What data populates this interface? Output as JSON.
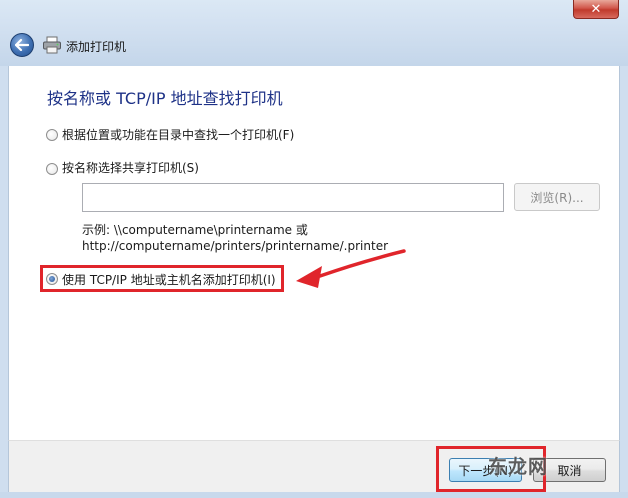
{
  "window": {
    "title": "添加打印机",
    "close_glyph": "✕"
  },
  "page": {
    "heading": "按名称或 TCP/IP 地址查找打印机"
  },
  "options": [
    {
      "label": "根据位置或功能在目录中查找一个打印机(F)",
      "selected": false
    },
    {
      "label": "按名称选择共享打印机(S)",
      "selected": false
    },
    {
      "label": "使用 TCP/IP 地址或主机名添加打印机(I)",
      "selected": true
    }
  ],
  "share": {
    "input_value": "",
    "browse_label": "浏览(R)...",
    "example_line1": "示例: \\\\computername\\printername 或",
    "example_line2": "http://computername/printers/printername/.printer"
  },
  "footer": {
    "next_label": "下一步(N)",
    "cancel_label": "取消"
  },
  "watermark": "东龙网",
  "colors": {
    "heading": "#1e3287",
    "highlight": "#e0252b",
    "titlebar": "#cfdeef"
  },
  "icons": [
    "back-arrow-icon",
    "printer-icon",
    "close-icon"
  ]
}
